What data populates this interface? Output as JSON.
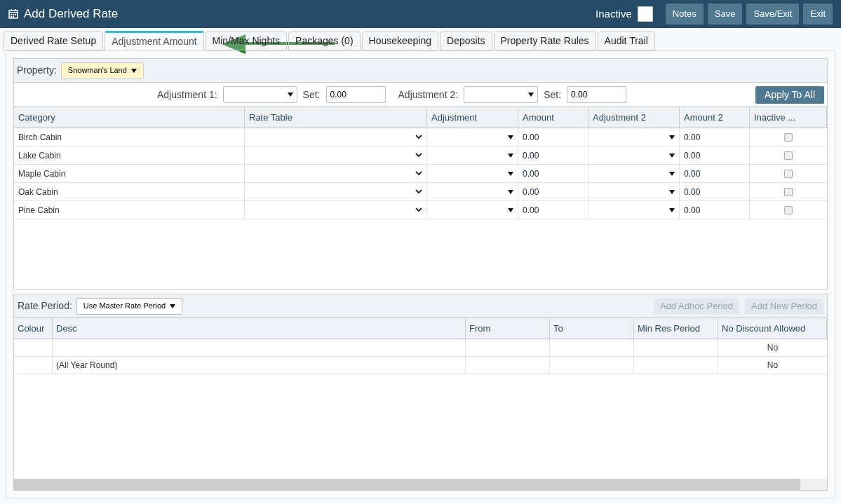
{
  "window": {
    "title": "Add Derived Rate"
  },
  "header": {
    "inactive_label": "Inactive",
    "inactive_checked": false,
    "buttons": [
      "Notes",
      "Save",
      "Save/Exit",
      "Exit"
    ]
  },
  "tabs": [
    {
      "label": "Derived Rate Setup",
      "selected": false
    },
    {
      "label": "Adjustment Amount",
      "selected": true
    },
    {
      "label": "Min/Max Nights",
      "selected": false
    },
    {
      "label": "Packages (0)",
      "selected": false
    },
    {
      "label": "Housekeeping",
      "selected": false
    },
    {
      "label": "Deposits",
      "selected": false
    },
    {
      "label": "Property Rate Rules",
      "selected": false
    },
    {
      "label": "Audit Trail",
      "selected": false
    }
  ],
  "property": {
    "label": "Property:",
    "value": "Snowman's Land"
  },
  "adjust_bar": {
    "adjustment_1_label": "Adjustment 1:",
    "set_1_label": "Set:",
    "set_1_value": "0.00",
    "adjustment_2_label": "Adjustment 2:",
    "set_2_label": "Set:",
    "set_2_value": "0.00",
    "apply_button": "Apply To All"
  },
  "rates_table": {
    "columns": [
      "Category",
      "Rate Table",
      "Adjustment",
      "Amount",
      "Adjustment 2",
      "Amount 2",
      "Inactive ..."
    ],
    "rows": [
      {
        "category": "Birch Cabin",
        "amount": "0.00",
        "amount_2": "0.00",
        "inactive": false
      },
      {
        "category": "Lake Cabin",
        "amount": "0.00",
        "amount_2": "0.00",
        "inactive": false
      },
      {
        "category": "Maple Cabin",
        "amount": "0.00",
        "amount_2": "0.00",
        "inactive": false
      },
      {
        "category": "Oak Cabin",
        "amount": "0.00",
        "amount_2": "0.00",
        "inactive": false
      },
      {
        "category": "Pine Cabin",
        "amount": "0.00",
        "amount_2": "0.00",
        "inactive": false
      }
    ]
  },
  "rate_period": {
    "label": "Rate Period:",
    "value": "Use Master Rate Period",
    "buttons": [
      {
        "label": "Add Adhoc Period",
        "disabled": true
      },
      {
        "label": "Add New Period",
        "disabled": true
      }
    ]
  },
  "periods_table": {
    "columns": [
      "Colour",
      "Desc",
      "From",
      "To",
      "Min Res Period",
      "No Discount Allowed"
    ],
    "rows": [
      {
        "desc": "",
        "no_discount": "No"
      },
      {
        "desc": "(All Year Round)",
        "no_discount": "No"
      }
    ]
  }
}
